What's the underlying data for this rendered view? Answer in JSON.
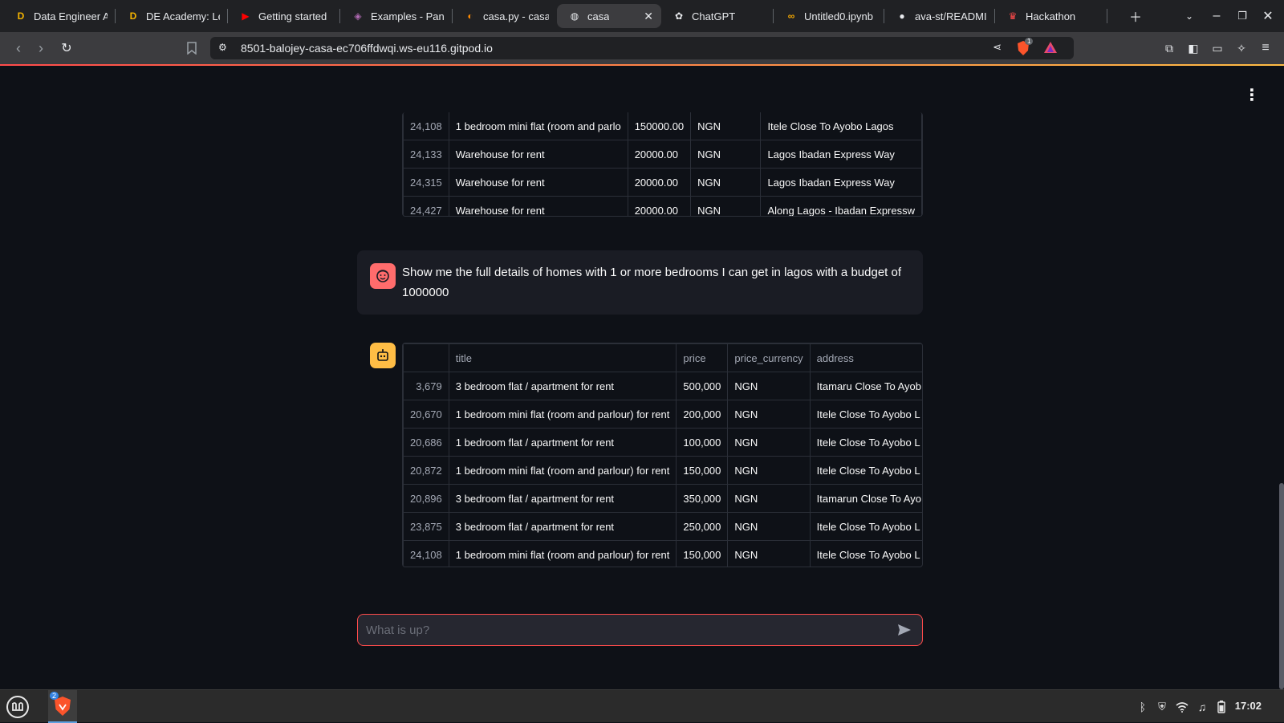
{
  "browser": {
    "tabs": [
      {
        "icon": "d-favicon-icon",
        "title": "Data Engineer A"
      },
      {
        "icon": "d-favicon-icon",
        "title": "DE Academy: Le"
      },
      {
        "icon": "youtube-icon",
        "title": "Getting started"
      },
      {
        "icon": "pandas-icon",
        "title": "Examples - Pan"
      },
      {
        "icon": "gitpod-icon",
        "title": "casa.py - casa -"
      },
      {
        "icon": "globe-icon",
        "title": "casa"
      },
      {
        "icon": "chatgpt-icon",
        "title": "ChatGPT"
      },
      {
        "icon": "colab-icon",
        "title": "Untitled0.ipynb"
      },
      {
        "icon": "github-icon",
        "title": "ava-st/READMI"
      },
      {
        "icon": "streamlit-icon",
        "title": "Hackathon"
      }
    ],
    "active_tab_index": 5,
    "url": "8501-balojey-casa-ec706ffdwqi.ws-eu116.gitpod.io",
    "brave_badge": "1"
  },
  "top_table": {
    "rows": [
      {
        "idx": "24,108",
        "title": "1 bedroom mini flat (room and parlo",
        "price": "150000.00",
        "currency": "NGN",
        "address": "Itele Close To Ayobo Lagos"
      },
      {
        "idx": "24,133",
        "title": "Warehouse for rent",
        "price": "20000.00",
        "currency": "NGN",
        "address": "Lagos Ibadan Express Way"
      },
      {
        "idx": "24,315",
        "title": "Warehouse for rent",
        "price": "20000.00",
        "currency": "NGN",
        "address": "Lagos Ibadan Express Way"
      },
      {
        "idx": "24,427",
        "title": "Warehouse for rent",
        "price": "20000.00",
        "currency": "NGN",
        "address": "Along Lagos - Ibadan Expressw"
      }
    ]
  },
  "user_message": "Show me the full details of homes with 1 or more bedrooms I can get in lagos with a budget of 1000000",
  "result_table": {
    "columns": [
      "",
      "title",
      "price",
      "price_currency",
      "address"
    ],
    "rows": [
      {
        "idx": "3,679",
        "title": "3 bedroom flat / apartment for rent",
        "price": "500,000",
        "currency": "NGN",
        "address": "Itamaru Close To Ayob"
      },
      {
        "idx": "20,670",
        "title": "1 bedroom mini flat (room and parlour) for rent",
        "price": "200,000",
        "currency": "NGN",
        "address": "Itele Close To Ayobo L"
      },
      {
        "idx": "20,686",
        "title": "1 bedroom flat / apartment for rent",
        "price": "100,000",
        "currency": "NGN",
        "address": "Itele Close To Ayobo L"
      },
      {
        "idx": "20,872",
        "title": "1 bedroom mini flat (room and parlour) for rent",
        "price": "150,000",
        "currency": "NGN",
        "address": "Itele Close To Ayobo L"
      },
      {
        "idx": "20,896",
        "title": "3 bedroom flat / apartment for rent",
        "price": "350,000",
        "currency": "NGN",
        "address": "Itamarun Close To Ayo"
      },
      {
        "idx": "23,875",
        "title": "3 bedroom flat / apartment for rent",
        "price": "250,000",
        "currency": "NGN",
        "address": "Itele Close To Ayobo L"
      },
      {
        "idx": "24,108",
        "title": "1 bedroom mini flat (room and parlour) for rent",
        "price": "150,000",
        "currency": "NGN",
        "address": "Itele Close To Ayobo L"
      }
    ]
  },
  "chat_input": {
    "placeholder": "What is up?"
  },
  "taskbar": {
    "clock": "17:02",
    "app_badge": "2"
  },
  "colors": {
    "accent": "#ff4b4b",
    "user_avatar": "#ff6c6c",
    "bot_avatar": "#ffbd45",
    "background": "#0e1117"
  }
}
